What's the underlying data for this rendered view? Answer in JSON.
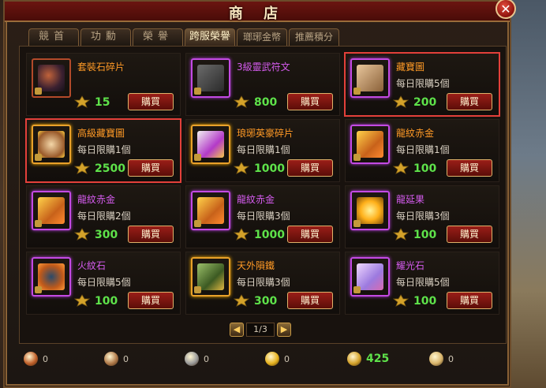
{
  "window": {
    "title": "商 店",
    "close_label": "✕"
  },
  "tabs": [
    {
      "label": "競首"
    },
    {
      "label": "功勳"
    },
    {
      "label": "榮譽"
    },
    {
      "label": "跨服榮譽",
      "active": true
    },
    {
      "label": "瑯琊金幣"
    },
    {
      "label": "推薦積分"
    }
  ],
  "items": [
    {
      "name": "套裝石碎片",
      "limit": "",
      "price": "15",
      "buy": "購買",
      "name_color": "orange",
      "frame": "red",
      "highlight": false,
      "icon": "ore-shard-icon"
    },
    {
      "name": "3級靈武符文",
      "limit": "",
      "price": "800",
      "buy": "購買",
      "name_color": "purple",
      "frame": "purple",
      "highlight": false,
      "icon": "rune-icon"
    },
    {
      "name": "藏寶圖",
      "limit": "每日限購5個",
      "price": "200",
      "buy": "購買",
      "name_color": "orange",
      "frame": "purple",
      "highlight": true,
      "icon": "treasure-map-icon"
    },
    {
      "name": "高級藏寶圖",
      "limit": "每日限購1個",
      "price": "2500",
      "buy": "購買",
      "name_color": "orange",
      "frame": "gold",
      "highlight": true,
      "icon": "advanced-map-icon"
    },
    {
      "name": "琅琊英豪碎片",
      "limit": "每日限購1個",
      "price": "1000",
      "buy": "購買",
      "name_color": "orange",
      "frame": "gold",
      "highlight": false,
      "icon": "hero-fragment-icon"
    },
    {
      "name": "龍紋赤金",
      "limit": "每日限購1個",
      "price": "100",
      "buy": "購買",
      "name_color": "orange",
      "frame": "purple",
      "highlight": false,
      "icon": "gold-ingot-icon"
    },
    {
      "name": "龍紋赤金",
      "limit": "每日限購2個",
      "price": "300",
      "buy": "購買",
      "name_color": "purple",
      "frame": "purple",
      "highlight": false,
      "icon": "gold-ingot-icon"
    },
    {
      "name": "龍紋赤金",
      "limit": "每日限購3個",
      "price": "1000",
      "buy": "購買",
      "name_color": "purple",
      "frame": "purple",
      "highlight": false,
      "icon": "gold-ingot-icon"
    },
    {
      "name": "龍延果",
      "limit": "每日限購3個",
      "price": "100",
      "buy": "購買",
      "name_color": "purple",
      "frame": "purple",
      "highlight": false,
      "icon": "dragon-fruit-icon"
    },
    {
      "name": "火紋石",
      "limit": "每日限購5個",
      "price": "100",
      "buy": "購買",
      "name_color": "purple",
      "frame": "purple",
      "highlight": false,
      "icon": "fire-stone-icon"
    },
    {
      "name": "天外隕鐵",
      "limit": "每日限購3個",
      "price": "300",
      "buy": "購買",
      "name_color": "orange",
      "frame": "gold",
      "highlight": false,
      "icon": "meteor-iron-icon"
    },
    {
      "name": "耀光石",
      "limit": "每日限購5個",
      "price": "100",
      "buy": "購買",
      "name_color": "purple",
      "frame": "purple",
      "highlight": false,
      "icon": "glow-stone-icon"
    }
  ],
  "pager": {
    "prev": "◀",
    "current": "1/3",
    "next": "▶"
  },
  "currencies": [
    {
      "icon": "medal-icon",
      "value": "0",
      "color": "#c0602a"
    },
    {
      "icon": "shield-icon",
      "value": "0",
      "color": "#b07a4a"
    },
    {
      "icon": "gear-icon",
      "value": "0",
      "color": "#9a9a9a"
    },
    {
      "icon": "gold-coin-icon",
      "value": "0",
      "color": "#e6b21e"
    },
    {
      "icon": "cross-server-honor-icon",
      "value": "425",
      "color": "#d4a22a",
      "green": true
    },
    {
      "icon": "scroll-icon",
      "value": "0",
      "color": "#d8b46a"
    }
  ],
  "colors": {
    "name_orange": "#ff9a26",
    "name_purple": "#d65cf0",
    "price_green": "#5ee24a",
    "highlight_red": "#e3403a"
  }
}
